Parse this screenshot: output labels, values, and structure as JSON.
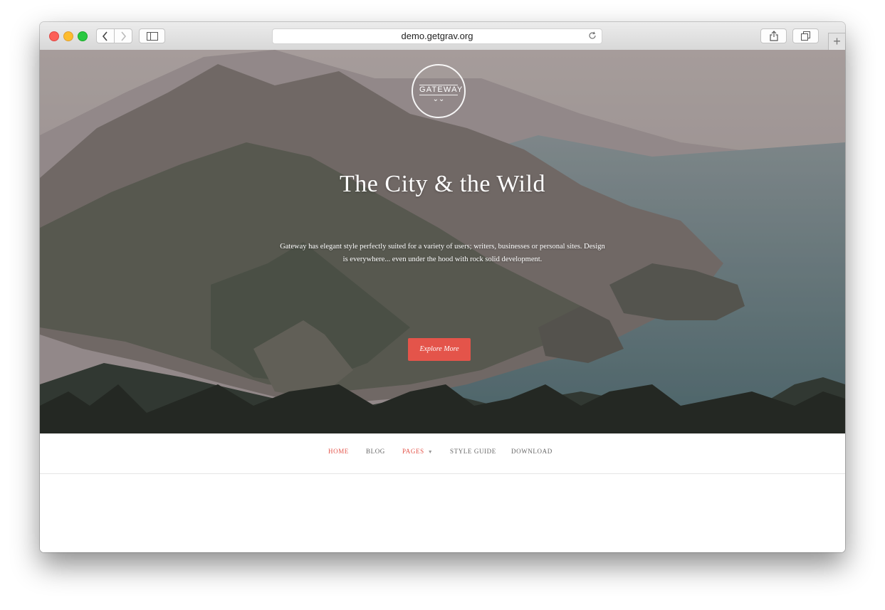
{
  "browser": {
    "url": "demo.getgrav.org",
    "back_icon": "chevron-left-icon",
    "forward_icon": "chevron-right-icon",
    "sidebar_icon": "sidebar-icon",
    "share_icon": "share-icon",
    "tabs_icon": "tabs-overview-icon",
    "reload_icon": "reload-icon",
    "newtab_label": "+"
  },
  "hero": {
    "logo_text": "GATEWAY",
    "logo_chevron": "⌄⌄",
    "title": "The City & the Wild",
    "description": "Gateway has elegant style perfectly suited for a variety of users; writers, businesses or personal sites. Design is everywhere... even under the hood with rock solid development.",
    "button_label": "Explore More"
  },
  "nav": {
    "items": [
      {
        "label": "HOME",
        "active": true
      },
      {
        "label": "BLOG",
        "active": false
      },
      {
        "label": "PAGES",
        "active": false,
        "dropdown": true
      },
      {
        "label": "STYLE GUIDE",
        "active": false
      },
      {
        "label": "DOWNLOAD",
        "active": false
      }
    ],
    "dropdown_caret": "▼"
  },
  "colors": {
    "accent": "#e4544a",
    "nav_text": "#666666"
  }
}
